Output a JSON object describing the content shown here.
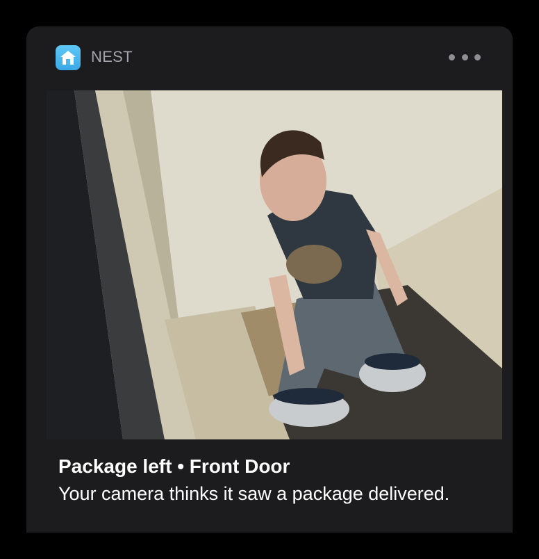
{
  "app": {
    "name": "NEST",
    "icon": "home-icon",
    "icon_color": "#4bb8f0"
  },
  "header": {
    "more_icon": "ellipsis-icon"
  },
  "notification": {
    "title": "Package left • Front Door",
    "body": "Your camera thinks it saw a package delivered."
  },
  "colors": {
    "background": "#000000",
    "card": "#1c1c1e",
    "app_name": "#a4a4aa",
    "text": "#ffffff"
  }
}
